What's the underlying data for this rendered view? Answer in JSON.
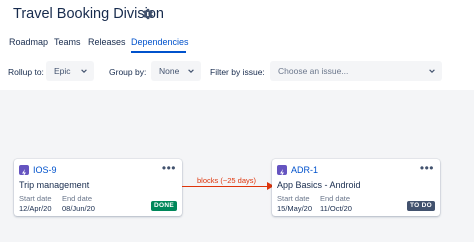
{
  "header": {
    "title": "Travel Booking Division",
    "settings_icon": "gear-icon"
  },
  "tabs": [
    {
      "label": "Roadmap",
      "active": false
    },
    {
      "label": "Teams",
      "active": false
    },
    {
      "label": "Releases",
      "active": false
    },
    {
      "label": "Dependencies",
      "active": true
    }
  ],
  "filters": {
    "rollup_label": "Rollup to:",
    "rollup_value": "Epic",
    "groupby_label": "Group by:",
    "groupby_value": "None",
    "issue_label": "Filter by issue:",
    "issue_placeholder": "Choose an issue..."
  },
  "cards": [
    {
      "key": "IOS-9",
      "summary": "Trip management",
      "start_label": "Start date",
      "start_value": "12/Apr/20",
      "end_label": "End date",
      "end_value": "08/Jun/20",
      "status": "DONE",
      "more": "•••"
    },
    {
      "key": "ADR-1",
      "summary": "App Basics - Android",
      "start_label": "Start date",
      "start_value": "15/May/20",
      "end_label": "End date",
      "end_value": "11/Oct/20",
      "status": "TO DO",
      "more": "•••"
    }
  ],
  "dependency": {
    "label": "blocks (~25 days)"
  },
  "colors": {
    "accent": "#0052cc",
    "epic": "#6554c0",
    "done": "#00875a",
    "todo": "#42526e",
    "dependency": "#de350b"
  }
}
